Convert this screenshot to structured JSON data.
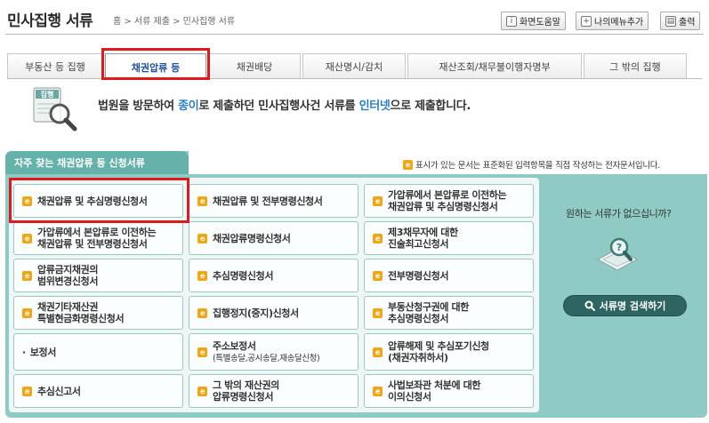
{
  "header": {
    "title": "민사집행 서류",
    "breadcrumb": "홈 > 서류 제출 > 민사집행 서류",
    "buttons": {
      "help": "화면도움말",
      "add_menu": "나의메뉴추가",
      "print": "출력"
    }
  },
  "tabs": [
    {
      "label": "부동산 등 집행"
    },
    {
      "label": "채권압류 등"
    },
    {
      "label": "채권배당"
    },
    {
      "label": "재산명시/감치"
    },
    {
      "label": "재산조회/채무불이행자명부"
    },
    {
      "label": "그 밖의 집행"
    }
  ],
  "active_tab_index": 1,
  "banner": {
    "icon_label": "집행",
    "text_1": "법원을 방문하여 ",
    "hl_1": "종이",
    "text_2": "로 제출하던 민사집행사건 서류를 ",
    "hl_2": "인터넷",
    "text_3": "으로 제출합니다."
  },
  "panel": {
    "title": "자주 찾는 채권압류 등 신청서류",
    "note": "표시가 있는 문서는 표준화된 입력항목을 직접 작성하는 전자문서입니다.",
    "e_icon": "e",
    "items": [
      {
        "label": "채권압류 및 추심명령신청서",
        "e": true
      },
      {
        "label": "채권압류 및 전부명령신청서",
        "e": true
      },
      {
        "label": "가압류에서 본압류로 이전하는\n채권압류 및 추심명령신청서",
        "e": true
      },
      {
        "label": "가압류에서 본압류로 이전하는\n채권압류 및 전부명령신청서",
        "e": true
      },
      {
        "label": "채권압류명령신청서",
        "e": true
      },
      {
        "label": "제3채무자에 대한\n진술최고신청서",
        "e": true
      },
      {
        "label": "압류금지채권의\n범위변경신청서",
        "e": true
      },
      {
        "label": "추심명령신청서",
        "e": true
      },
      {
        "label": "전부명령신청서",
        "e": true
      },
      {
        "label": "채권기타재산권\n특별현금화명령신청서",
        "e": true
      },
      {
        "label": "집행정지(중지)신청서",
        "e": true
      },
      {
        "label": "부동산청구권에 대한\n추심명령신청서",
        "e": true
      },
      {
        "label": "보정서",
        "e": false
      },
      {
        "label": "주소보정서",
        "sub": "(특별송달,공시송달,재송달신청)",
        "e": true
      },
      {
        "label": "압류해제 및 추심포기신청",
        "sub": "(채권자취하서)",
        "e": true
      },
      {
        "label": "추심신고서",
        "e": true
      },
      {
        "label": "그 밖의 재산권의\n압류명령신청서",
        "e": true
      },
      {
        "label": "사법보좌관 처분에 대한\n이의신청서",
        "e": true
      }
    ]
  },
  "side": {
    "question": "원하는 서류가 없으십니까?",
    "search_button": "서류명 검색하기"
  },
  "highlight_color": "#e0191e",
  "accent_color": "#65b2aa"
}
